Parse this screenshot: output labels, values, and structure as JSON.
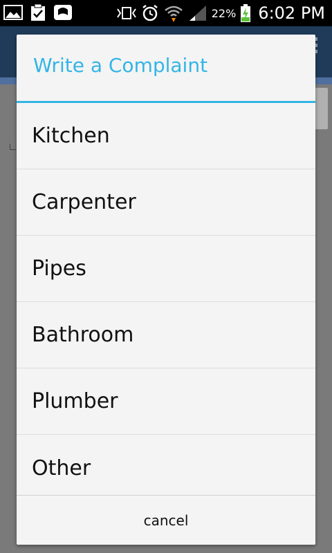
{
  "status_bar": {
    "battery_percent": "22%",
    "time": "6:02 PM",
    "icons": [
      "gallery-icon",
      "clipboard-check-icon",
      "app-notification-icon",
      "vibrate-icon",
      "alarm-icon",
      "wifi-icon",
      "signal-icon",
      "battery-charging-icon"
    ]
  },
  "dialog": {
    "title": "Write a Complaint",
    "options": [
      {
        "label": "Kitchen"
      },
      {
        "label": "Carpenter"
      },
      {
        "label": "Pipes"
      },
      {
        "label": "Bathroom"
      },
      {
        "label": "Plumber"
      },
      {
        "label": "Other"
      }
    ],
    "cancel_label": "cancel"
  },
  "colors": {
    "accent": "#33b5e5",
    "status_bar": "#000000",
    "action_bar": "#1f3b59"
  }
}
